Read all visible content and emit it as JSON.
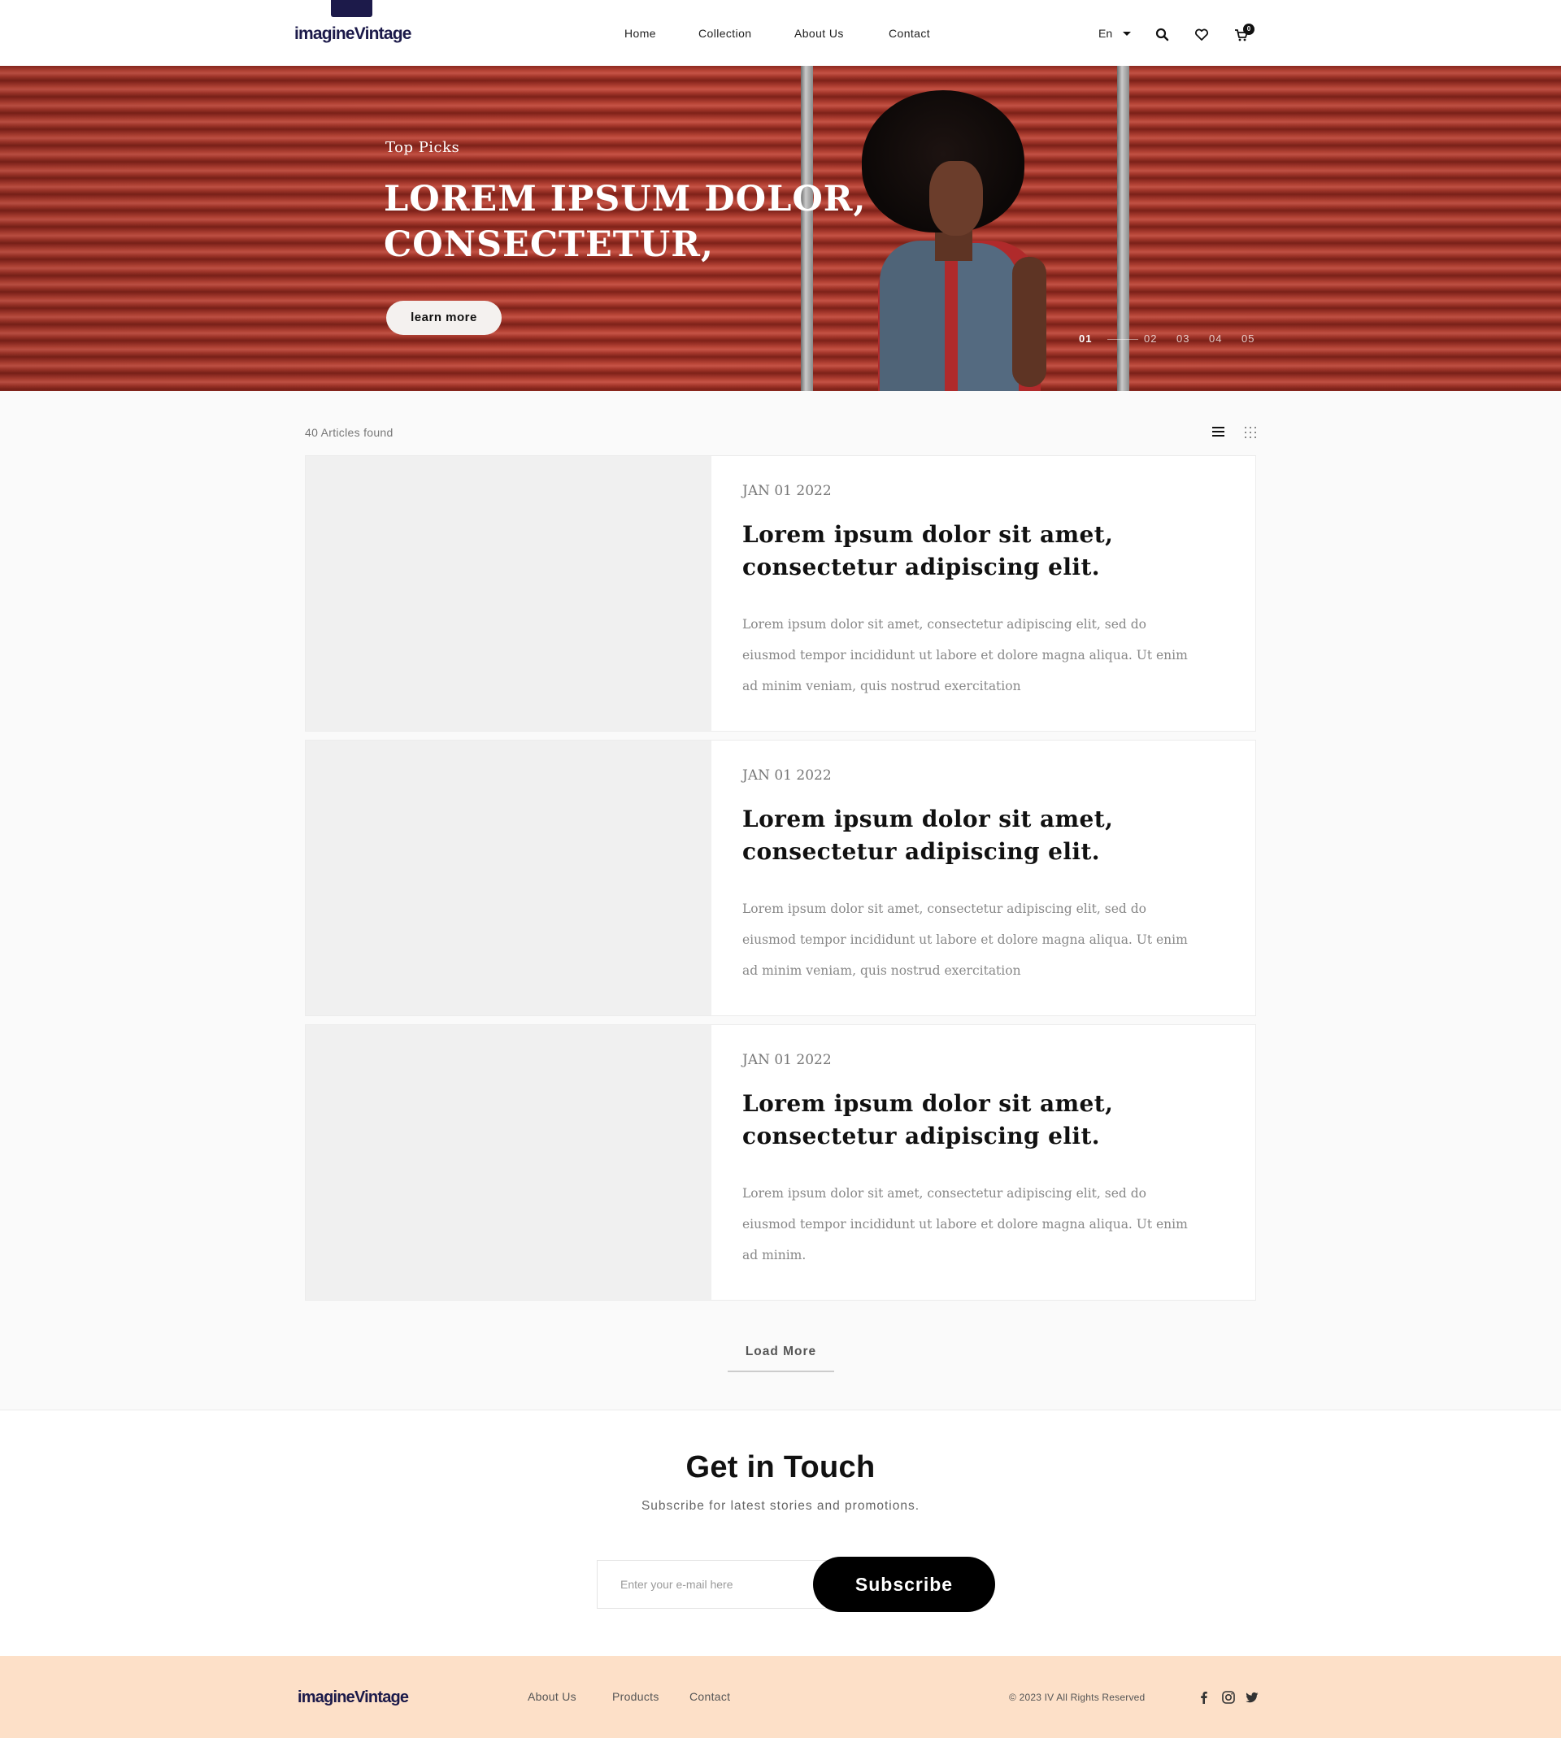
{
  "header": {
    "logo": "imagineVintage",
    "nav": [
      "Home",
      "Collection",
      "About Us",
      "Contact"
    ],
    "language": "En",
    "cart_count": "0"
  },
  "hero": {
    "kicker": "Top Picks",
    "title": "LOREM IPSUM DOLOR, CONSECTETUR,",
    "cta": "learn more",
    "slides": [
      "01",
      "02",
      "03",
      "04",
      "05"
    ],
    "active_slide": "01"
  },
  "listing": {
    "count": "40 Articles found",
    "articles": [
      {
        "date": "JAN 01 2022",
        "title": "Lorem ipsum dolor sit amet, consectetur adipiscing elit.",
        "excerpt": "Lorem ipsum dolor sit amet, consectetur adipiscing elit, sed do eiusmod tempor incididunt ut labore et dolore magna aliqua. Ut enim ad minim veniam, quis nostrud exercitation"
      },
      {
        "date": "JAN 01 2022",
        "title": "Lorem ipsum dolor sit amet, consectetur adipiscing elit.",
        "excerpt": "Lorem ipsum dolor sit amet, consectetur adipiscing elit, sed do eiusmod tempor incididunt ut labore et dolore magna aliqua. Ut enim ad minim veniam, quis nostrud exercitation"
      },
      {
        "date": "JAN 01 2022",
        "title": "Lorem ipsum dolor sit amet, consectetur adipiscing elit.",
        "excerpt": "Lorem ipsum dolor sit amet, consectetur adipiscing elit, sed do eiusmod tempor incididunt ut labore et dolore magna aliqua. Ut enim ad minim."
      }
    ],
    "load_more": "Load More"
  },
  "contact": {
    "title": "Get in Touch",
    "subtitle": "Subscribe for latest stories and promotions.",
    "email_placeholder": "Enter your e-mail here",
    "subscribe": "Subscribe"
  },
  "footer": {
    "logo": "imagineVintage",
    "links": [
      "About Us",
      "Products",
      "Contact"
    ],
    "copyright": "© 2023 IV All Rights Reserved",
    "social": [
      "facebook-icon",
      "instagram-icon",
      "twitter-icon"
    ]
  },
  "colors": {
    "brand": "#1c1a4a",
    "hero_red": "#a3352b",
    "footer_bg": "#fde0c8",
    "button_dark": "#000000"
  }
}
